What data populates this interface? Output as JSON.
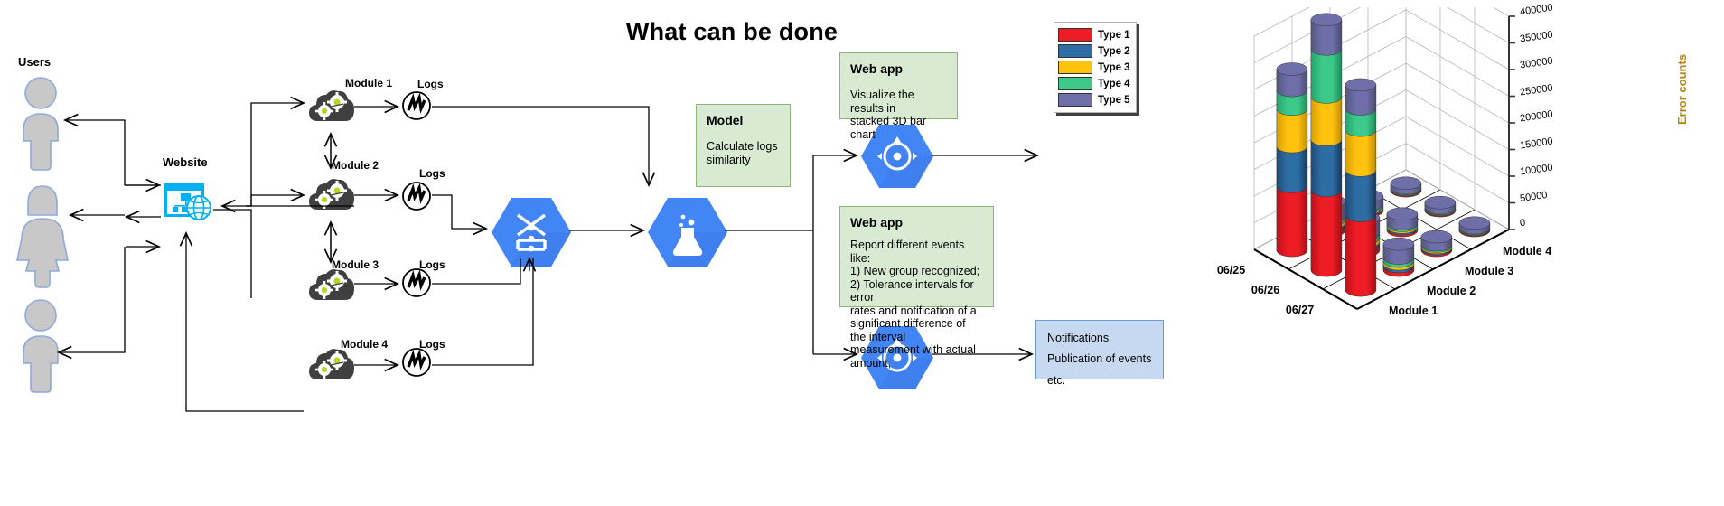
{
  "title": "What can be done",
  "diagram": {
    "users_label": "Users",
    "website_label": "Website",
    "modules": [
      {
        "label": "Module 1",
        "logs_label": "Logs"
      },
      {
        "label": "Module 2",
        "logs_label": "Logs"
      },
      {
        "label": "Module 3",
        "logs_label": "Logs"
      },
      {
        "label": "Module 4",
        "logs_label": "Logs"
      }
    ],
    "notes": [
      {
        "id": "model-note",
        "title": "Model",
        "body": "Calculate logs\nsimilarity"
      },
      {
        "id": "webapp-visualize-note",
        "title": "Web app",
        "body": "Visualize the results in\nstacked 3D bar chart"
      },
      {
        "id": "webapp-report-note",
        "title": "Web app",
        "body": "Report different events like:\n1) New group recognized;\n2) Tolerance intervals for error\nrates and notification of a\nsignificant difference of the interval\nmeasurement with actual amount;"
      }
    ],
    "notifications_box": {
      "lines": [
        "Notifications",
        "Publication of events",
        "etc."
      ]
    },
    "icons": {
      "user": "user-icon",
      "website": "website-globe-icon",
      "module": "cloud-gears-icon",
      "logs": "log-pulse-icon",
      "dataflow": "dataflow-hex-icon",
      "model": "lab-flask-hex-icon",
      "webapp": "app-engine-hex-icon"
    },
    "colors": {
      "accent_blue": "#4285f4",
      "website_cyan": "#00b0f0",
      "note_green_fill": "#d9ead3",
      "note_green_border": "#8cb57a",
      "note_blue_fill": "#c6d9f0",
      "note_blue_border": "#6f9bd1",
      "person_gray": "#c8c8c8",
      "cloud_dark": "#404040"
    }
  },
  "chart_data": {
    "type": "bar",
    "subtype": "3d-stacked-cylinder",
    "title": "",
    "xlabel": "",
    "zlabel": "",
    "ylabel": "Error counts",
    "ylim": [
      0,
      400000
    ],
    "yticks": [
      0,
      50000,
      100000,
      150000,
      200000,
      250000,
      300000,
      350000,
      400000
    ],
    "ytick_labels": [
      "0",
      "50000",
      "100000",
      "150000",
      "200000",
      "250000",
      "300000",
      "350000",
      "400000"
    ],
    "grid": true,
    "legend_position": "top-left",
    "legend": [
      "Type 1",
      "Type 2",
      "Type 3",
      "Type 4",
      "Type 5"
    ],
    "series_colors": [
      "#ee1c25",
      "#2e6da4",
      "#ffc20e",
      "#3cc98a",
      "#6e6fa8"
    ],
    "date_axis": [
      "06/25",
      "06/26",
      "06/27"
    ],
    "module_axis": [
      "Module 1",
      "Module 2",
      "Module 3",
      "Module 4"
    ],
    "series": [
      {
        "name": "Type 1",
        "values": [
          [
            120000,
            8000,
            3000,
            1500
          ],
          [
            150000,
            9000,
            3500,
            1500
          ],
          [
            140000,
            7000,
            3000,
            1500
          ]
        ]
      },
      {
        "name": "Type 2",
        "values": [
          [
            75000,
            6000,
            2500,
            1200
          ],
          [
            95000,
            7000,
            3000,
            1200
          ],
          [
            85000,
            5000,
            2500,
            1200
          ]
        ]
      },
      {
        "name": "Type 3",
        "values": [
          [
            70000,
            6000,
            2500,
            1200
          ],
          [
            80000,
            7000,
            3000,
            1200
          ],
          [
            75000,
            5000,
            2500,
            1200
          ]
        ]
      },
      {
        "name": "Type 4",
        "values": [
          [
            35000,
            7000,
            3000,
            1200
          ],
          [
            90000,
            8000,
            3500,
            1200
          ],
          [
            40000,
            6000,
            2500,
            1200
          ]
        ]
      },
      {
        "name": "Type 5",
        "values": [
          [
            40000,
            28000,
            16000,
            9000
          ],
          [
            55000,
            30000,
            18000,
            10000
          ],
          [
            45000,
            26000,
            15000,
            9000
          ]
        ]
      }
    ]
  }
}
